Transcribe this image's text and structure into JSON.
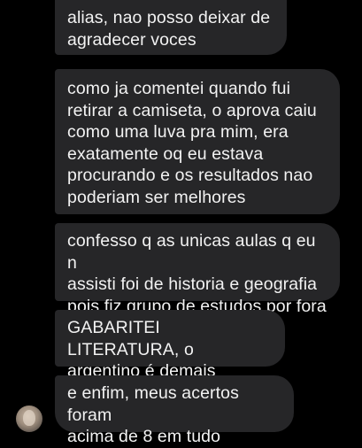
{
  "conversation": {
    "messages": [
      {
        "text": "alias, nao posso deixar de\nagradecer voces"
      },
      {
        "text": "como ja comentei quando fui\nretirar a camiseta, o aprova caiu\ncomo uma luva pra mim, era\nexatamente oq eu estava\nprocurando e os resultados nao\npoderiam ser melhores"
      },
      {
        "text": "confesso q as unicas aulas q eu n\nassisti foi de historia e geografia\npois fiz grupo de estudos por fora"
      },
      {
        "text": "GABARITEI LITERATURA, o\nargentino é demais"
      },
      {
        "text": "e enfim, meus acertos foram\nacima de 8 em tudo"
      }
    ],
    "sender_avatar": {
      "icon": "profile-photo-icon"
    }
  },
  "colors": {
    "background": "#000000",
    "bubble": "#262628",
    "text": "#f2f2f2"
  }
}
